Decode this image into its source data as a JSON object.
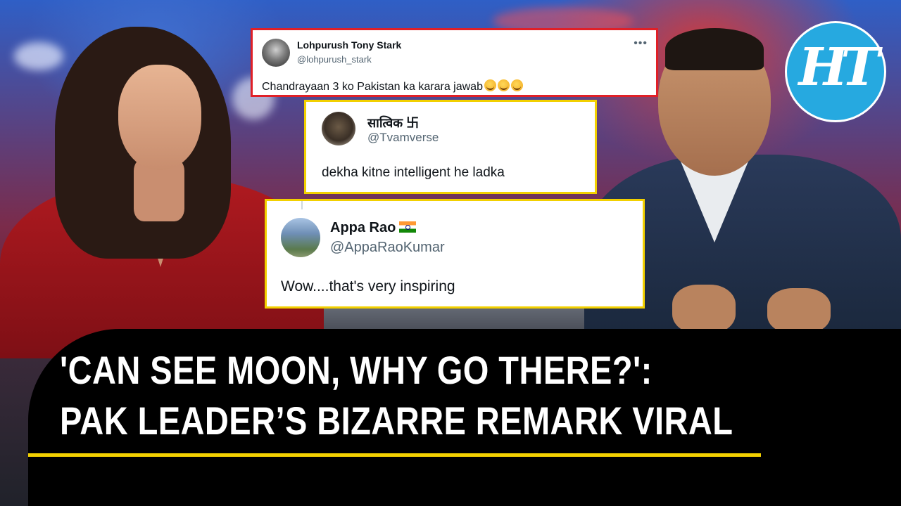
{
  "tweets": [
    {
      "name": "Lohpurush Tony Stark",
      "handle": "@lohpurush_stark",
      "text": "Chandrayaan 3 ko Pakistan ka karara jawab",
      "emoji_count": 3,
      "border_color": "#e02027"
    },
    {
      "name": "सात्विक 卐",
      "handle": "@Tvamverse",
      "text": "dekha kitne intelligent he ladka",
      "border_color": "#f2d000"
    },
    {
      "name": "Appa Rao",
      "handle": "@AppaRaoKumar",
      "text": "Wow....that's very inspiring",
      "name_icon": "india-flag-icon",
      "border_color": "#f2d000"
    }
  ],
  "logo": {
    "text": "HT",
    "color": "#26a9e0"
  },
  "headline": {
    "line1": "'CAN SEE MOON, WHY GO THERE?':",
    "line2": "PAK LEADER’S BIZARRE REMARK VIRAL",
    "accent_color": "#f2d000"
  }
}
